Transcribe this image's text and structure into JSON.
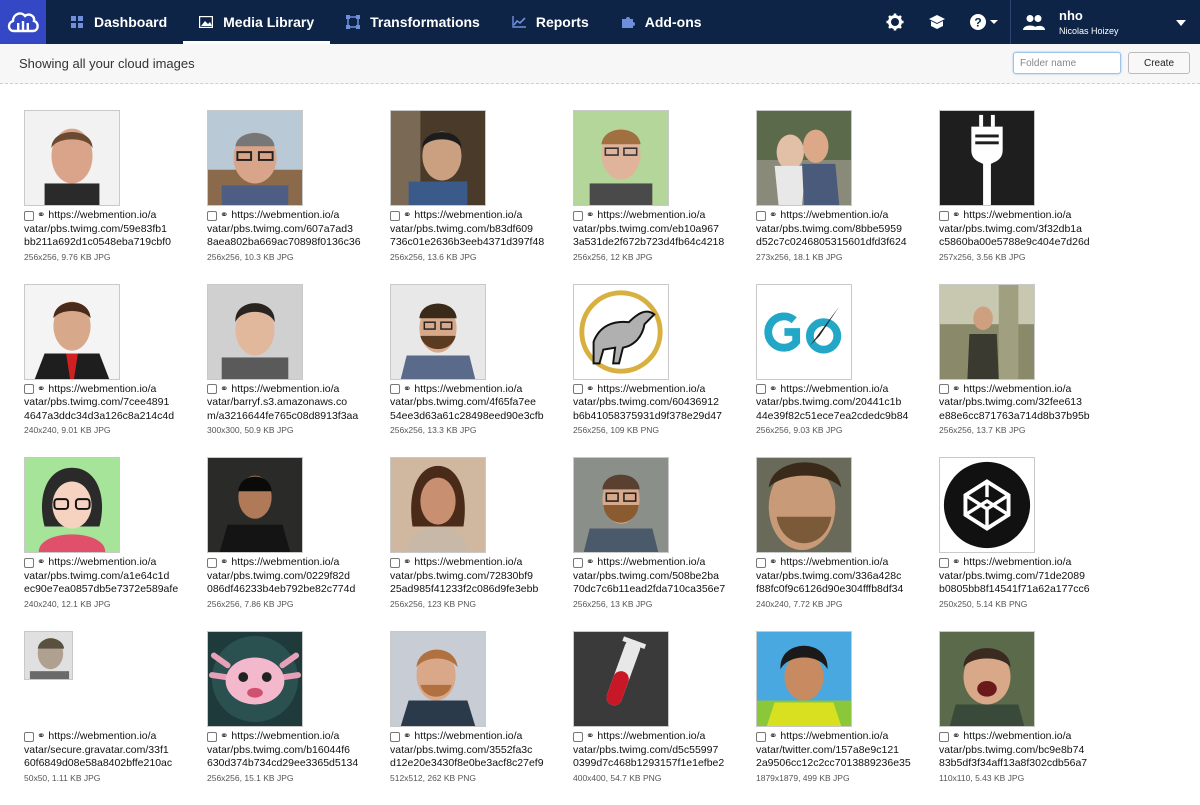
{
  "nav": {
    "items": [
      {
        "label": "Dashboard",
        "icon": "dashboard-icon"
      },
      {
        "label": "Media Library",
        "icon": "image-icon",
        "active": true
      },
      {
        "label": "Transformations",
        "icon": "transform-icon"
      },
      {
        "label": "Reports",
        "icon": "chart-icon"
      },
      {
        "label": "Add-ons",
        "icon": "puzzle-icon"
      }
    ]
  },
  "user": {
    "username": "nho",
    "full_name": "Nicolas Hoizey"
  },
  "subheader": {
    "title": "Showing all your cloud images",
    "folder_placeholder": "Folder name",
    "create_label": "Create"
  },
  "images": [
    {
      "url1": "https://webmention.io/a",
      "url2": "vatar/pbs.twimg.com/59e83fb1",
      "url3": "bb211a692d1c0548eba719cbf0",
      "info": "256x256, 9.76 KB JPG"
    },
    {
      "url1": "https://webmention.io/a",
      "url2": "vatar/pbs.twimg.com/607a7ad3",
      "url3": "8aea802ba669ac70898f0136c36",
      "info": "256x256, 10.3 KB JPG"
    },
    {
      "url1": "https://webmention.io/a",
      "url2": "vatar/pbs.twimg.com/b83df609",
      "url3": "736c01e2636b3eeb4371d397f48",
      "info": "256x256, 13.6 KB JPG"
    },
    {
      "url1": "https://webmention.io/a",
      "url2": "vatar/pbs.twimg.com/eb10a967",
      "url3": "3a531de2f672b723d4fb64c4218",
      "info": "256x256, 12 KB JPG"
    },
    {
      "url1": "https://webmention.io/a",
      "url2": "vatar/pbs.twimg.com/8bbe5959",
      "url3": "d52c7c0246805315601dfd3f624",
      "info": "273x256, 18.1 KB JPG"
    },
    {
      "url1": "https://webmention.io/a",
      "url2": "vatar/pbs.twimg.com/3f32db1a",
      "url3": "c5860ba00e5788e9c404e7d26d",
      "info": "257x256, 3.56 KB JPG"
    },
    {
      "url1": "https://webmention.io/a",
      "url2": "vatar/pbs.twimg.com/7cee4891",
      "url3": "4647a3ddc34d3a126c8a214c4d",
      "info": "240x240, 9.01 KB JPG"
    },
    {
      "url1": "https://webmention.io/a",
      "url2": "vatar/barryf.s3.amazonaws.co",
      "url3": "m/a3216644fe765c08d8913f3aa",
      "info": "300x300, 50.9 KB JPG"
    },
    {
      "url1": "https://webmention.io/a",
      "url2": "vatar/pbs.twimg.com/4f65fa7ee",
      "url3": "54ee3d63a61c28498eed90e3cfb",
      "info": "256x256, 13.3 KB JPG"
    },
    {
      "url1": "https://webmention.io/a",
      "url2": "vatar/pbs.twimg.com/60436912",
      "url3": "b6b41058375931d9f378e29d47",
      "info": "256x256, 109 KB PNG"
    },
    {
      "url1": "https://webmention.io/a",
      "url2": "vatar/pbs.twimg.com/20441c1b",
      "url3": "44e39f82c51ece7ea2cdedc9b84",
      "info": "256x256, 9.03 KB JPG"
    },
    {
      "url1": "https://webmention.io/a",
      "url2": "vatar/pbs.twimg.com/32fee613",
      "url3": "e88e6cc871763a714d8b37b95b",
      "info": "256x256, 13.7 KB JPG"
    },
    {
      "url1": "https://webmention.io/a",
      "url2": "vatar/pbs.twimg.com/a1e64c1d",
      "url3": "ec90e7ea0857db5e7372e589afe",
      "info": "240x240, 12.1 KB JPG"
    },
    {
      "url1": "https://webmention.io/a",
      "url2": "vatar/pbs.twimg.com/0229f82d",
      "url3": "086df46233b4eb792be82c774d",
      "info": "256x256, 7.86 KB JPG"
    },
    {
      "url1": "https://webmention.io/a",
      "url2": "vatar/pbs.twimg.com/72830bf9",
      "url3": "25ad985f41233f2c086d9fe3ebb",
      "info": "256x256, 123 KB PNG"
    },
    {
      "url1": "https://webmention.io/a",
      "url2": "vatar/pbs.twimg.com/508be2ba",
      "url3": "70dc7c6b11ead2fda710ca356e7",
      "info": "256x256, 13 KB JPG"
    },
    {
      "url1": "https://webmention.io/a",
      "url2": "vatar/pbs.twimg.com/336a428c",
      "url3": "f88fc0f9c6126d90e304fffb8df34",
      "info": "240x240, 7.72 KB JPG"
    },
    {
      "url1": "https://webmention.io/a",
      "url2": "vatar/pbs.twimg.com/71de2089",
      "url3": "b0805bb8f14541f71a62a177cc6",
      "info": "250x250, 5.14 KB PNG"
    },
    {
      "url1": "https://webmention.io/a",
      "url2": "vatar/secure.gravatar.com/33f1",
      "url3": "60f6849d08e58a8402bffe210ac",
      "info": "50x50, 1.11 KB JPG"
    },
    {
      "url1": "https://webmention.io/a",
      "url2": "vatar/pbs.twimg.com/b16044f6",
      "url3": "630d374b734cd29ee3365d5134",
      "info": "256x256, 15.1 KB JPG"
    },
    {
      "url1": "https://webmention.io/a",
      "url2": "vatar/pbs.twimg.com/3552fa3c",
      "url3": "d12e20e3430f8e0be3acf8c27ef9",
      "info": "512x512, 262 KB PNG"
    },
    {
      "url1": "https://webmention.io/a",
      "url2": "vatar/pbs.twimg.com/d5c55997",
      "url3": "0399d7c468b1293157f1e1efbe2",
      "info": "400x400, 54.7 KB PNG"
    },
    {
      "url1": "https://webmention.io/a",
      "url2": "vatar/twitter.com/157a8e9c121",
      "url3": "2a9506cc12c2cc7013889236e35",
      "info": "1879x1879, 499 KB JPG"
    },
    {
      "url1": "https://webmention.io/a",
      "url2": "vatar/pbs.twimg.com/bc9e8b74",
      "url3": "83b5df3f34aff13a8f302cdb56a7",
      "info": "110x110, 5.43 KB JPG"
    }
  ]
}
